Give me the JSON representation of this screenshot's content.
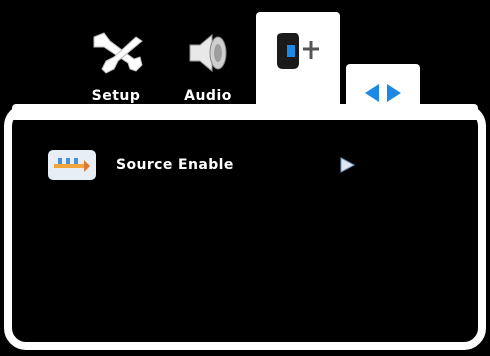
{
  "tabs": [
    {
      "label": "Setup",
      "icon": "wrench-screwdriver-icon"
    },
    {
      "label": "Audio",
      "icon": "speaker-icon"
    },
    {
      "label": "",
      "icon": "tv-input-icon",
      "active": true
    },
    {
      "label": "",
      "icon": "left-right-arrows-icon"
    }
  ],
  "menu": {
    "items": [
      {
        "label": "Source Enable",
        "icon": "source-icon",
        "action": "arrow-right-icon"
      }
    ]
  },
  "colors": {
    "background": "#000000",
    "frame": "#ffffff",
    "accent_blue": "#1e88e5"
  }
}
